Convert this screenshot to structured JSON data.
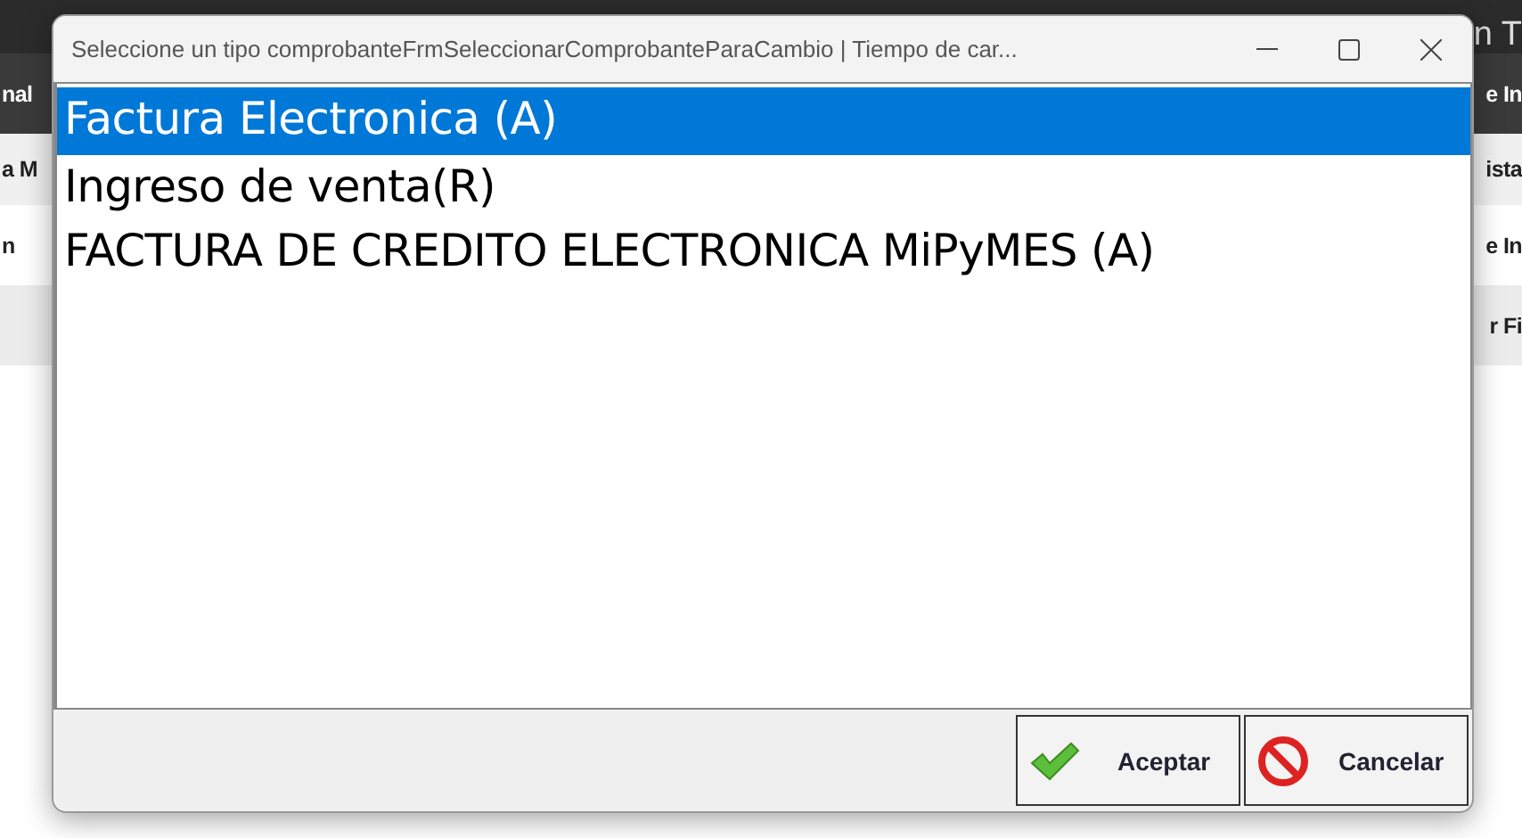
{
  "background_app": {
    "top_bar_fragment": "n T",
    "left_fragments": [
      "nal",
      "a M",
      "n"
    ],
    "right_fragments": [
      "e In",
      "ista",
      "e In",
      "r Fi"
    ]
  },
  "dialog": {
    "title": "Seleccione un tipo comprobanteFrmSeleccionarComprobanteParaCambio | Tiempo de car...",
    "items": [
      {
        "label": "Factura Electronica (A)",
        "selected": true
      },
      {
        "label": "Ingreso de venta(R)",
        "selected": false
      },
      {
        "label": "FACTURA DE CREDITO ELECTRONICA MiPyMES (A)",
        "selected": false
      }
    ],
    "buttons": [
      {
        "kind": "accept",
        "label": "Aceptar"
      },
      {
        "kind": "cancel",
        "label": "Cancelar"
      }
    ]
  }
}
